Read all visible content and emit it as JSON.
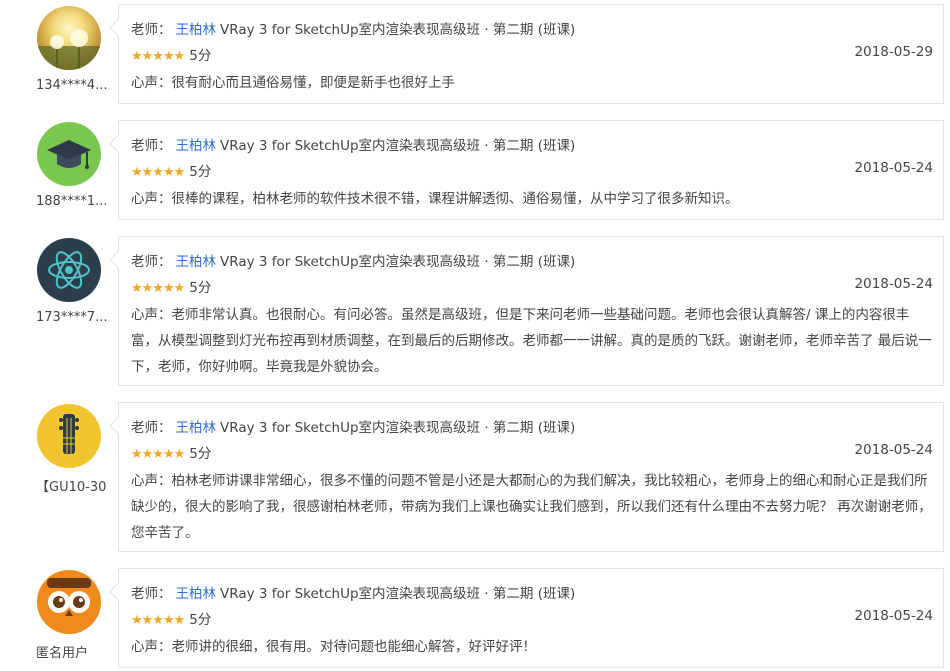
{
  "reviews": [
    {
      "user": "134****4...",
      "teacher_label": "老师：",
      "teacher_name": "王柏林",
      "course": "VRay 3 for SketchUp室内渲染表现高级班 · 第二期 (班课)",
      "stars": "★★★★★",
      "score": "5分",
      "date": "2018-05-29",
      "comment": "心声：很有耐心而且通俗易懂，即便是新手也很好上手",
      "avatar_icon": "dandelion-photo-icon"
    },
    {
      "user": "188****1...",
      "teacher_label": "老师：",
      "teacher_name": "王柏林",
      "course": "VRay 3 for SketchUp室内渲染表现高级班 · 第二期 (班课)",
      "stars": "★★★★★",
      "score": "5分",
      "date": "2018-05-24",
      "comment": "心声：很棒的课程，柏林老师的软件技术很不错，课程讲解透彻、通俗易懂，从中学习了很多新知识。",
      "avatar_icon": "graduation-cap-icon"
    },
    {
      "user": "173****7...",
      "teacher_label": "老师：",
      "teacher_name": "王柏林",
      "course": "VRay 3 for SketchUp室内渲染表现高级班 · 第二期 (班课)",
      "stars": "★★★★★",
      "score": "5分",
      "date": "2018-05-24",
      "comment": "心声：老师非常认真。也很耐心。有问必答。虽然是高级班，但是下来问老师一些基础问题。老师也会很认真解答/ 课上的内容很丰富，从模型调整到灯光布控再到材质调整，在到最后的后期修改。老师都一一讲解。真的是质的飞跃。谢谢老师，老师辛苦了 最后说一下，老师，你好帅啊。毕竟我是外貌协会。",
      "avatar_icon": "atom-icon"
    },
    {
      "user": "【GU10-30",
      "teacher_label": "老师：",
      "teacher_name": "王柏林",
      "course": "VRay 3 for SketchUp室内渲染表现高级班 · 第二期 (班课)",
      "stars": "★★★★★",
      "score": "5分",
      "date": "2018-05-24",
      "comment": "心声：柏林老师讲课非常细心，很多不懂的问题不管是小还是大都耐心的为我们解决，我比较粗心，老师身上的细心和耐心正是我们所缺少的，很大的影响了我，很感谢柏林老师，带病为我们上课也确实让我们感到，所以我们还有什么理由不去努力呢？ 再次谢谢老师，您辛苦了。",
      "avatar_icon": "guitar-icon"
    },
    {
      "user": "匿名用户",
      "teacher_label": "老师：",
      "teacher_name": "王柏林",
      "course": "VRay 3 for SketchUp室内渲染表现高级班 · 第二期 (班课)",
      "stars": "★★★★★",
      "score": "5分",
      "date": "2018-05-24",
      "comment": "心声：老师讲的很细，很有用。对待问题也能细心解答，好评好评！",
      "avatar_icon": "owl-icon"
    }
  ],
  "colors": {
    "teacher_link": "#2a6fd1",
    "star": "#f5a623",
    "border": "#e2e2e2"
  }
}
